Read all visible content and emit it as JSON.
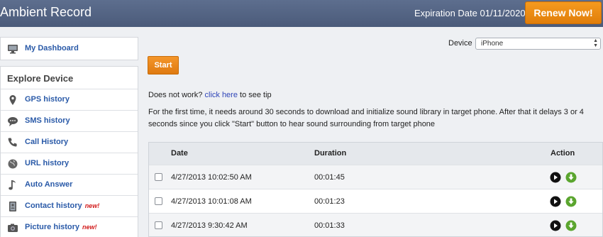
{
  "header": {
    "app_title": "Ambient Record",
    "expiration": "Expiration Date 01/11/2020",
    "renew_label": "Renew Now!"
  },
  "sidebar": {
    "dashboard_label": "My Dashboard",
    "explore_heading": "Explore Device",
    "items": [
      {
        "label": "GPS history",
        "icon": "map-pin-icon",
        "badge": ""
      },
      {
        "label": "SMS history",
        "icon": "chat-bubble-icon",
        "badge": ""
      },
      {
        "label": "Call History",
        "icon": "phone-icon",
        "badge": ""
      },
      {
        "label": "URL history",
        "icon": "globe-icon",
        "badge": ""
      },
      {
        "label": "Auto Answer",
        "icon": "music-note-icon",
        "badge": ""
      },
      {
        "label": "Contact history",
        "icon": "address-book-icon",
        "badge": "new!"
      },
      {
        "label": "Picture history",
        "icon": "camera-icon",
        "badge": "new!"
      }
    ]
  },
  "main": {
    "device_label": "Device",
    "device_value": "iPhone",
    "start_label": "Start",
    "tip_prefix": "Does not work?",
    "tip_link": "click here",
    "tip_suffix": "to see tip",
    "description": "For the first time, it needs around 30 seconds to download and initialize sound library in target phone. After that it delays 3 or 4 seconds since you click \"Start\" button to hear sound surrounding from target phone"
  },
  "table": {
    "columns": {
      "date": "Date",
      "duration": "Duration",
      "action": "Action"
    },
    "rows": [
      {
        "date": "4/27/2013 10:02:50 AM",
        "duration": "00:01:45"
      },
      {
        "date": "4/27/2013 10:01:08 AM",
        "duration": "00:01:23"
      },
      {
        "date": "4/27/2013 9:30:42 AM",
        "duration": "00:01:33"
      }
    ]
  },
  "colors": {
    "header_bg": "#55657f",
    "accent_orange": "#e8850f",
    "link_blue": "#2a5aa8",
    "badge_red": "#d21b1b",
    "download_green": "#5aa52e"
  }
}
